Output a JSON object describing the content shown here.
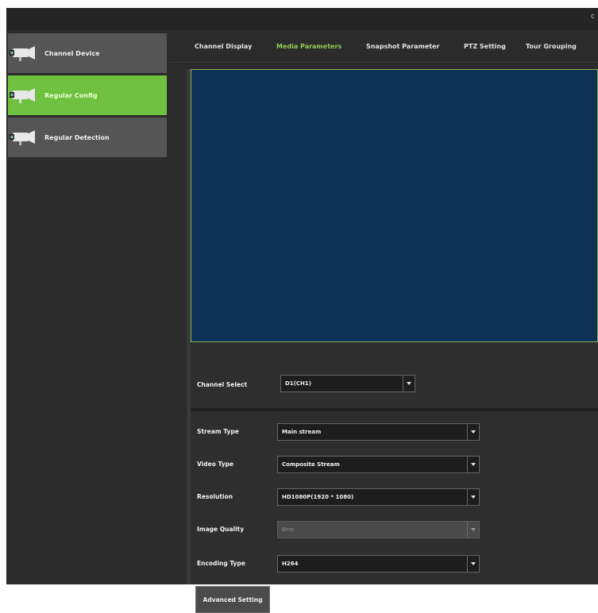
{
  "titlebar": {
    "corner_text": "c"
  },
  "sidebar": {
    "items": [
      {
        "label": "Channel Device",
        "icon": "camera-icon",
        "active": false
      },
      {
        "label": "Regular Config",
        "icon": "camera-icon",
        "active": true
      },
      {
        "label": "Regular Detection",
        "icon": "camera-icon",
        "active": false
      }
    ]
  },
  "tabs": [
    {
      "label": "Channel Display"
    },
    {
      "label": "Media Parameters",
      "active": true
    },
    {
      "label": "Snapshot Parameter"
    },
    {
      "label": "PTZ Setting"
    },
    {
      "label": "Tour Grouping"
    }
  ],
  "form": {
    "channel_select": {
      "label": "Channel Select",
      "value": "D1(CH1)"
    },
    "stream_type": {
      "label": "Stream Type",
      "value": "Main stream"
    },
    "video_type": {
      "label": "Video Type",
      "value": "Composite Stream"
    },
    "resolution": {
      "label": "Resolution",
      "value": "HD1080P(1920 * 1080)"
    },
    "image_quality": {
      "label": "Image Quality",
      "value": "Best"
    },
    "encoding_type": {
      "label": "Encoding Type",
      "value": "H264"
    },
    "advanced_button": "Advanced Setting"
  },
  "colors": {
    "accent": "#6fc13f",
    "preview_bg": "#0d3154",
    "panel_bg": "#2b2b2b"
  }
}
